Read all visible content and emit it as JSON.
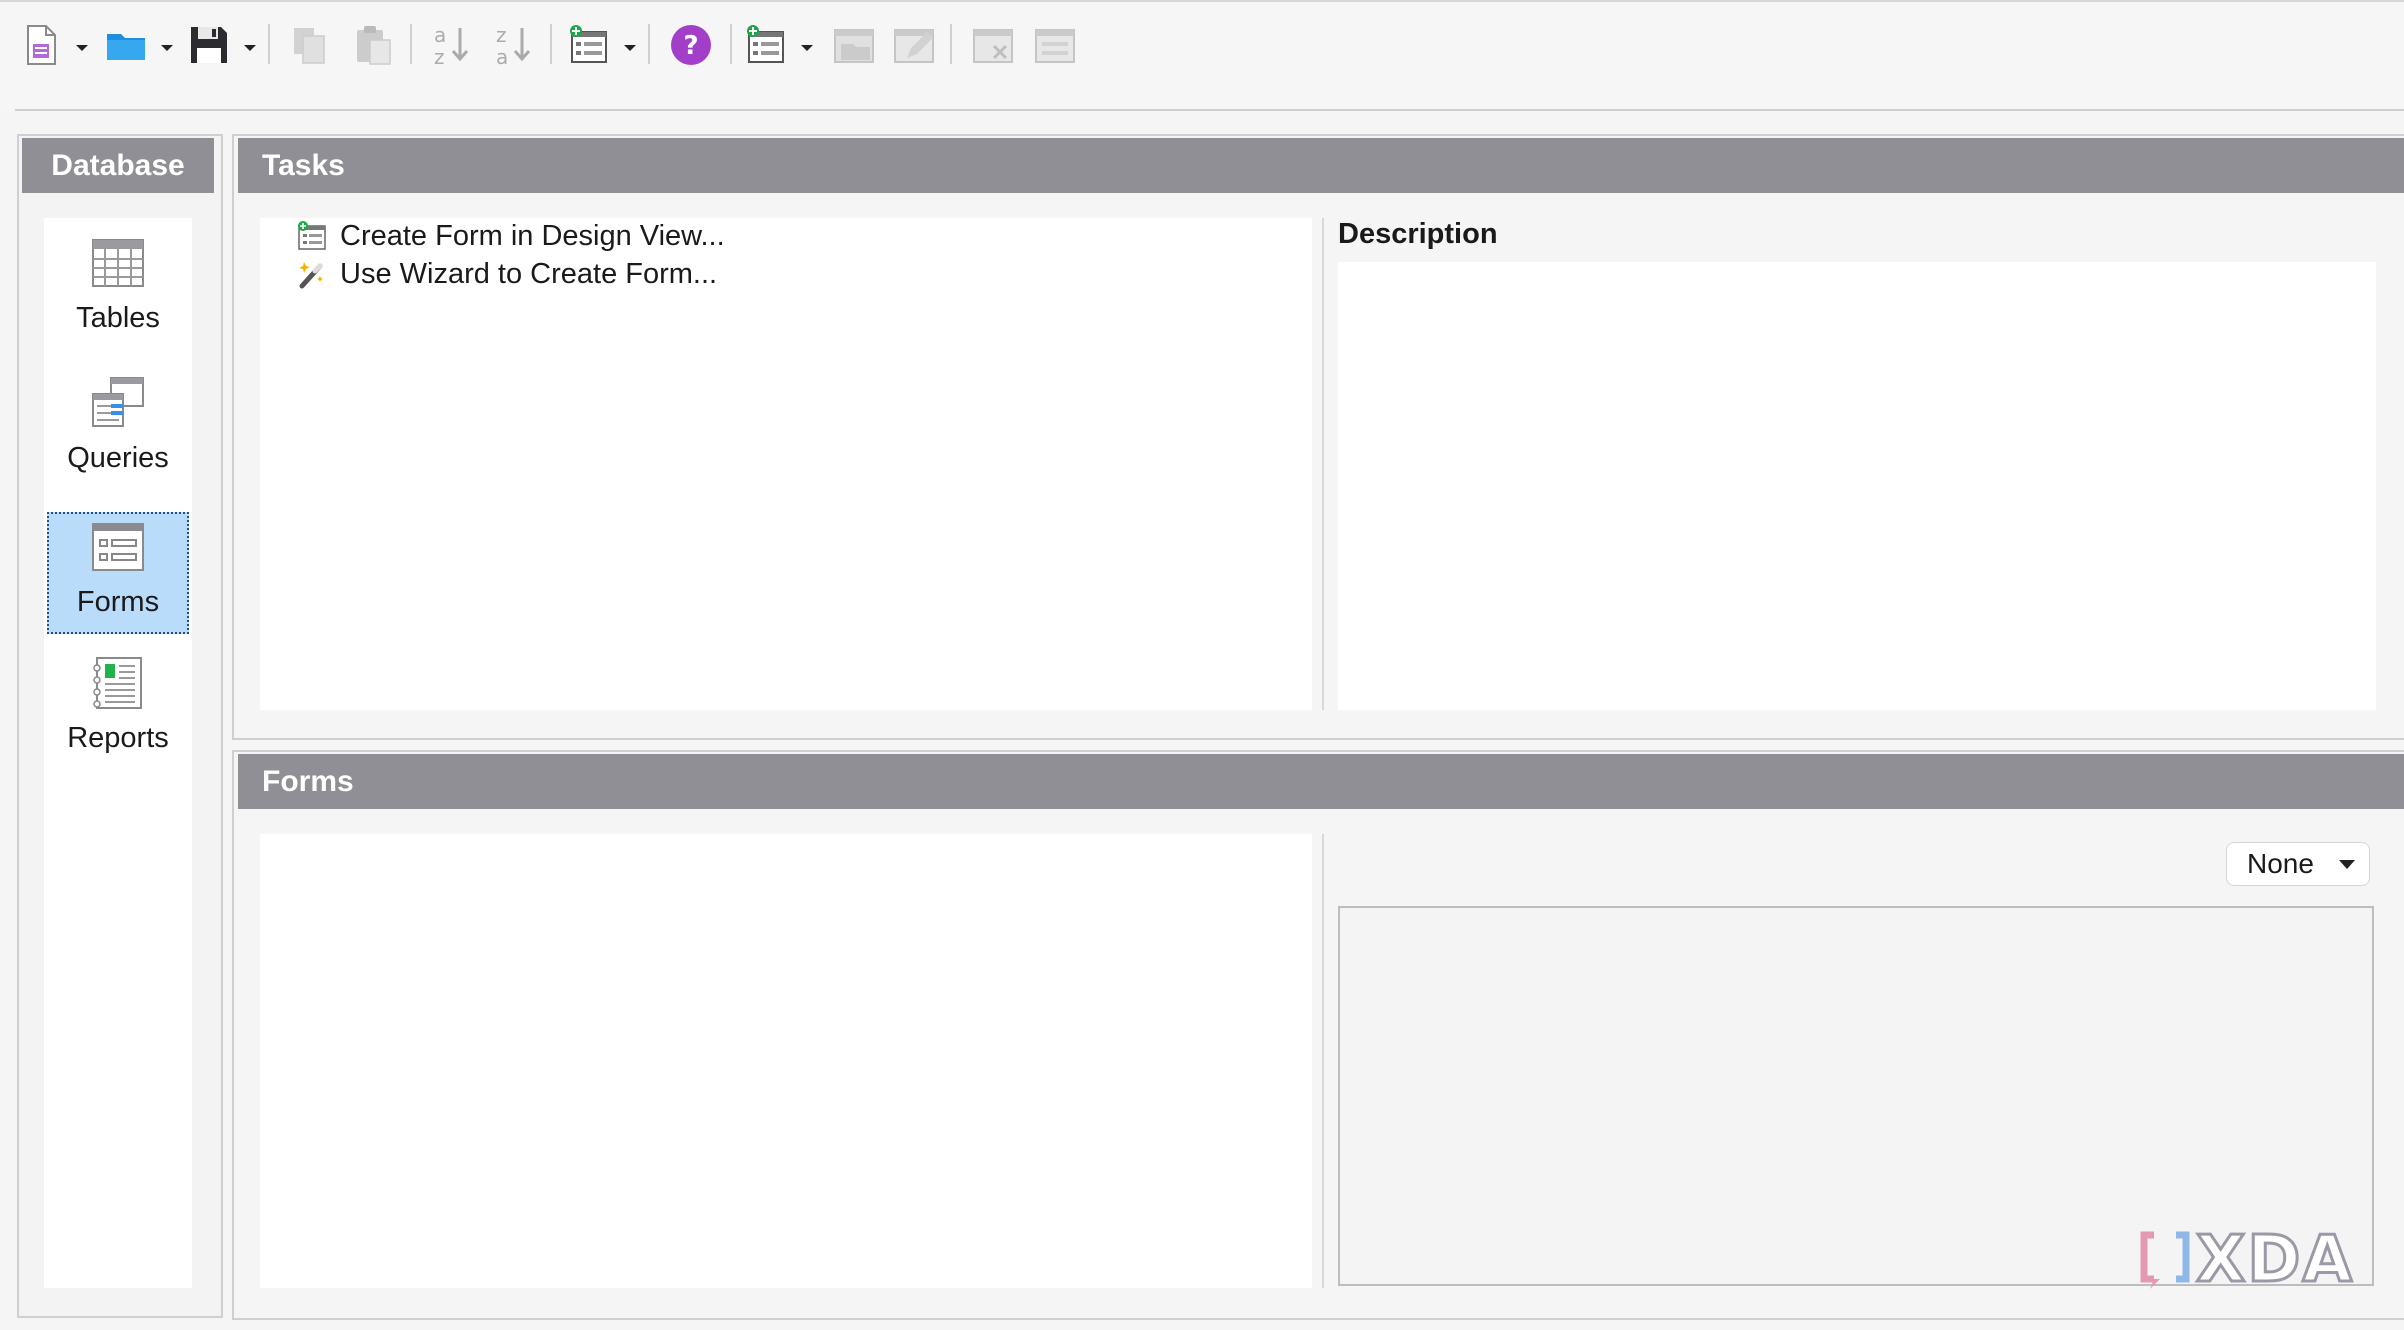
{
  "toolbar": {
    "buttons": [
      {
        "name": "new-document",
        "icon": "new-document-icon",
        "dropdown": true,
        "enabled": true
      },
      {
        "name": "open",
        "icon": "folder-icon",
        "dropdown": true,
        "enabled": true
      },
      {
        "name": "save",
        "icon": "floppy-disk-icon",
        "dropdown": true,
        "enabled": true
      },
      {
        "name": "copy",
        "icon": "copy-icon",
        "dropdown": false,
        "enabled": false
      },
      {
        "name": "paste",
        "icon": "clipboard-icon",
        "dropdown": false,
        "enabled": false
      },
      {
        "name": "sort-ascending",
        "icon": "sort-az-icon",
        "dropdown": false,
        "enabled": false
      },
      {
        "name": "sort-descending",
        "icon": "sort-za-icon",
        "dropdown": false,
        "enabled": false
      },
      {
        "name": "form",
        "icon": "form-icon",
        "dropdown": true,
        "enabled": true
      },
      {
        "name": "help",
        "icon": "help-icon",
        "dropdown": false,
        "enabled": true
      },
      {
        "name": "new-form",
        "icon": "new-form-icon",
        "dropdown": true,
        "enabled": true
      },
      {
        "name": "open-form",
        "icon": "open-form-icon",
        "dropdown": false,
        "enabled": false
      },
      {
        "name": "edit-form",
        "icon": "edit-form-icon",
        "dropdown": false,
        "enabled": false
      },
      {
        "name": "delete-form",
        "icon": "delete-form-icon",
        "dropdown": false,
        "enabled": false
      },
      {
        "name": "rename-form",
        "icon": "rename-form-icon",
        "dropdown": false,
        "enabled": false
      }
    ]
  },
  "database": {
    "title": "Database",
    "items": [
      {
        "label": "Tables",
        "icon": "table-icon",
        "selected": false
      },
      {
        "label": "Queries",
        "icon": "queries-icon",
        "selected": false
      },
      {
        "label": "Forms",
        "icon": "forms-icon",
        "selected": true
      },
      {
        "label": "Reports",
        "icon": "reports-icon",
        "selected": false
      }
    ]
  },
  "tasks": {
    "title": "Tasks",
    "items": [
      {
        "label": "Create Form in Design View...",
        "icon": "design-view-icon"
      },
      {
        "label": "Use Wizard to Create Form...",
        "icon": "wizard-wand-icon"
      }
    ],
    "description_label": "Description"
  },
  "forms": {
    "title": "Forms",
    "preview_option": "None"
  },
  "watermark": {
    "text": "XDA",
    "icon": "xda-logo-icon"
  }
}
